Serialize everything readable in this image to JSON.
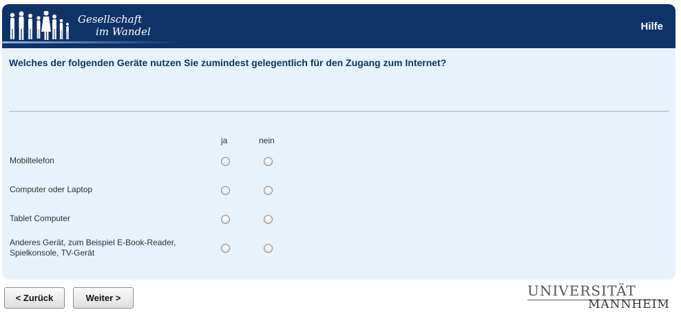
{
  "header": {
    "logo_line1": "Gesellschaft",
    "logo_line2": "im Wandel",
    "help_label": "Hilfe"
  },
  "question": {
    "text": "Welches der folgenden Geräte nutzen Sie zumindest gelegentlich für den Zugang zum Internet?"
  },
  "matrix": {
    "columns": [
      "ja",
      "nein"
    ],
    "rows": [
      {
        "label": "Mobiltelefon"
      },
      {
        "label": "Computer oder Laptop"
      },
      {
        "label": "Tablet Computer"
      },
      {
        "label_line1": "Anderes Gerät, zum Beispiel E-Book-Reader,",
        "label_line2": "Spielkonsole, TV-Gerät"
      }
    ]
  },
  "nav": {
    "back_label": "< Zurück",
    "next_label": "Weiter >"
  },
  "footer": {
    "uni_line1": "UNIVERSITÄT",
    "uni_line2": "MANNHEIM"
  },
  "colors": {
    "header_bg": "#0f3367",
    "panel_bg": "#e8f2fb",
    "question_text": "#0f3367"
  }
}
